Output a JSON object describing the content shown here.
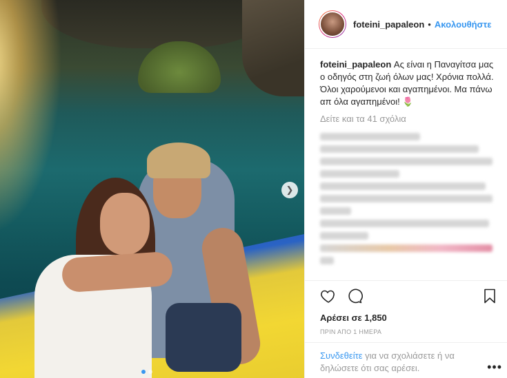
{
  "post": {
    "username": "foteini_papaleon",
    "separator": "•",
    "follow_label": "Ακολουθήστε",
    "caption_user": "foteini_papaleon",
    "caption_text": " Ας είναι η Παναγίτσα μας ο οδηγός στη ζωή όλων μας! Χρόνια πολλά. Όλοι χαρούμενοι και αγαπημένοι. Μα πάνω απ όλα αγαπημένοι! 🌷",
    "view_all_comments": "Δείτε και τα 41 σχόλια",
    "likes": "Αρέσει σε 1,850",
    "timestamp": "ΠΡΙΝ ΑΠΟ 1 ΗΜΕΡΑ",
    "login_link": "Συνδεθείτε",
    "login_text": " για να σχολιάσετε ή να δηλώσετε ότι σας αρέσει.",
    "more_label": "•••",
    "carousel": {
      "total": 2,
      "active": 1
    },
    "icons": {
      "like": "heart-icon",
      "comment": "comment-icon",
      "save": "bookmark-icon",
      "next": "chevron-right-icon"
    },
    "colors": {
      "link": "#3897f0",
      "muted": "#999999",
      "text": "#262626"
    }
  }
}
